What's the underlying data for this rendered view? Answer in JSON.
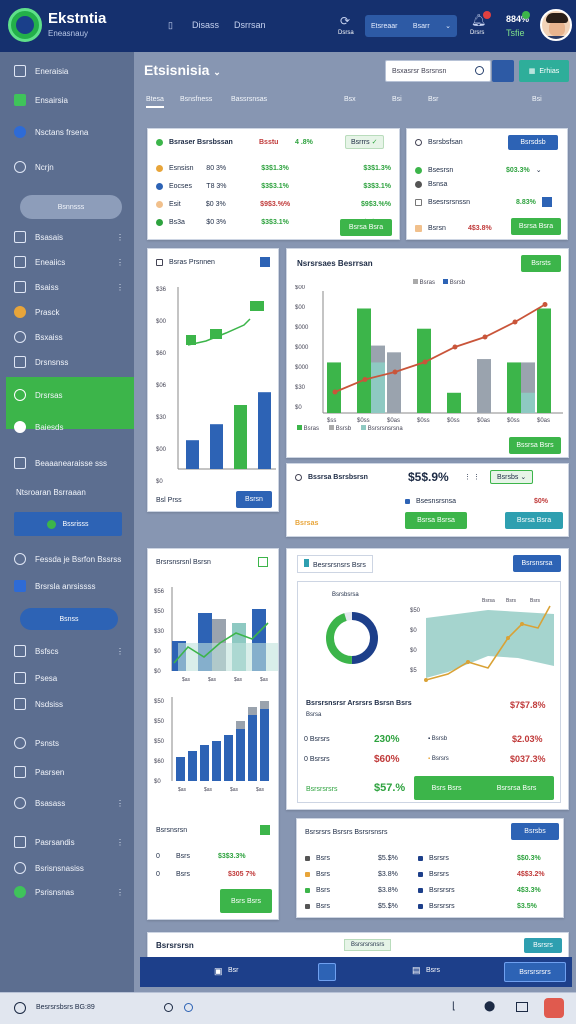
{
  "header": {
    "brand": "Ekstntia",
    "brand_sub": "Eneasnauy",
    "menu_labels": [
      "Disass",
      "Dsrrsan"
    ],
    "refresh_label": "Dsrsa",
    "dropdown_label": "Etsreaar",
    "dropdown_value": "Bsarr",
    "notif_label": "Drsrs",
    "stats_label": "884%",
    "stats_sub": "Tsfie"
  },
  "sidebar": {
    "items": [
      {
        "label": "Eneraisia"
      },
      {
        "label": "Ensairsia"
      },
      {
        "label": "Nsctans frsena"
      },
      {
        "label": "Ncrjn"
      },
      {
        "label": "Bsnnsss"
      },
      {
        "label": "Bsasais"
      },
      {
        "label": "Eneaiics"
      },
      {
        "label": "Bsaiss"
      },
      {
        "label": "Prasck"
      },
      {
        "label": "Bsxaiss"
      },
      {
        "label": "Drsnsnss"
      },
      {
        "label": "Drsrsas"
      },
      {
        "label": "Baiesds"
      },
      {
        "label": "Beaaanearaisse sss"
      },
      {
        "label": "Ntsroaran Bsrraaan"
      },
      {
        "label": "Bssrisss"
      },
      {
        "label": "Fessda je Bsrfon Bssrss"
      },
      {
        "label": "Brsrsla anrsissss"
      },
      {
        "label": "Bsnss"
      },
      {
        "label": "Bsfscs"
      },
      {
        "label": "Psesa"
      },
      {
        "label": "Nsdsiss"
      },
      {
        "label": "Psnsts"
      },
      {
        "label": "Pasrsen"
      },
      {
        "label": "Bsasass"
      },
      {
        "label": "Pasrsandis"
      },
      {
        "label": "Bsrisnsnasiss"
      },
      {
        "label": "Psrisnsnas"
      }
    ]
  },
  "main": {
    "title": "Etsisnisia",
    "search_placeholder": "Bsxasrsr Bsrsnsn",
    "action_label": "Erhias",
    "tabs": [
      "Btesa",
      "Bsnsfness",
      "Bassrsnsas",
      "Bsx",
      "Bsi",
      "Bsr",
      "Bsi"
    ]
  },
  "card_stats": {
    "title": "Bsraser Bsrsbssan",
    "header_val": "Bsstu",
    "header_pct": "4 .8%",
    "badge": "Bsrrrs",
    "rows": [
      {
        "label": "Esnsisn",
        "a": "80 3%",
        "b": "$3$1.3%",
        "color": "#e8a53a"
      },
      {
        "label": "Eocses",
        "a": "T8 3%",
        "b": "$3$3.1%",
        "color": "#2d63b5"
      },
      {
        "label": "Esit",
        "a": "$0 3%",
        "b": "$9$3.%%",
        "color": "#f1c08c"
      },
      {
        "label": "Bs3a",
        "a": "$0 3%",
        "b": "$3$3.1%",
        "color": "#2da23e"
      }
    ],
    "footer": "Bsrsa Bsra"
  },
  "card_profile": {
    "title": "Bsrsbsfsan",
    "btn": "Bsrsdsb",
    "rows": [
      {
        "label": "Bsesrsn",
        "v": "$03.3%"
      },
      {
        "label": "Bsnsa",
        "v": ""
      },
      {
        "label": "Bsesrsrsnssn",
        "v": "8.83%"
      }
    ],
    "footer_label": "Bsrsn",
    "footer_val": "4$3.8%",
    "footer_btn": "Bsrsa Bsra"
  },
  "card_bars_left": {
    "title": "Bsras Prsnnen",
    "footer_label": "Bsl Prss",
    "btn": "Bsrsn"
  },
  "card_combo": {
    "title": "Nsrsrsaes Besrrsan",
    "btn": "Bsrsts",
    "legend": [
      "Bsras",
      "Bsrsb",
      "Bsrsrsnsrsna"
    ],
    "footer_btn": "Bssrsa Bsrs"
  },
  "card_metrics": {
    "title": "Bssrsa Bsrsbsrsn",
    "value": "$5$.9%",
    "badge": "Bsrsbs",
    "row_label": "Bsesnsrsnsa",
    "row_val": "$0%",
    "foot_label": "Bsrsas",
    "btn1": "Bsrsa Bsrsa",
    "btn2": "Bsrsa Bsra"
  },
  "card_mini_charts": {
    "title": "Brsrsnsrsnl Bsrsn",
    "footer_title": "Bsrsnsrsn",
    "rows": [
      {
        "label": "Bsrs",
        "v": "$3$3.3%"
      },
      {
        "label": "Bsrs",
        "v": "$305 7%"
      }
    ],
    "btn": "Bsrs Bsrs"
  },
  "card_donut": {
    "title": "Besrsrsnsrs Bsrs",
    "btn": "Bsrsnsrsa",
    "chart_title": "Bsrsbsrsa",
    "legend": [
      "Bsrsa",
      "Bsrs",
      "Bsrs"
    ],
    "table_title": "Bsrsrsnsrsr Arsrsrs Bsrsn Bsrs",
    "table_rows": [
      {
        "label": "Bsrsa",
        "v": "$7$7.8%"
      },
      {
        "label": "Bsrsrs",
        "v": "230%",
        "m": "Bsrsb",
        "v2": "$2.03%"
      },
      {
        "label": "Bsrsrs",
        "v": "$60%",
        "m": "Bsrsrs",
        "v2": "$037.3%"
      }
    ],
    "foot_label": "Bsrsrsrsrs",
    "foot_val": "$57.%",
    "btn1": "Bsrs Bsrs",
    "btn2": "Bsrsrsa Bsrs"
  },
  "card_table": {
    "title": "Bsrsrsrs Bsrsrs Bsrsrsnsrs",
    "btn": "Bsrsbs",
    "rows": [
      {
        "a": "Bsrs",
        "b": "$5.$%",
        "c": "Bsrsrs",
        "d": "$$0.3%"
      },
      {
        "a": "Bsrs",
        "b": "$3.8%",
        "c": "Bsrsrs",
        "d": "4$$3.2%"
      },
      {
        "a": "Bsrs",
        "b": "$3.8%",
        "c": "Bsrsrsrs",
        "d": "4$3.3%"
      },
      {
        "a": "Bsrs",
        "b": "$5.$%",
        "c": "Bsrsrsrs",
        "d": "$3.5%"
      }
    ]
  },
  "card_bottom": {
    "title": "Bsrsrsrsn",
    "badge": "Bsrsrsrsnsrs",
    "btn": "Bsrsrs"
  },
  "bottombar": {
    "item1": "Bsr",
    "item2": "Bsrs",
    "btn": "Bsrsrsrsrs"
  },
  "footer": {
    "status": "Besrsrsbsrs BG:89"
  },
  "chart_data": [
    {
      "type": "bar",
      "title": "Bsras Prsnnen",
      "ylabels": [
        "$36",
        "$00",
        "$60",
        "$06",
        "$30",
        "$00",
        "$0"
      ],
      "series": [
        {
          "values": [
            1,
            2,
            3,
            4
          ],
          "color": "#2d63b5"
        },
        {
          "values": [
            4,
            6,
            9,
            12
          ],
          "color": "#3cb54a"
        }
      ],
      "top_series": [
        {
          "x": 1,
          "v": 18
        },
        {
          "x": 2,
          "v": 22
        },
        {
          "x": 3,
          "v": 26
        },
        {
          "x": 4,
          "v": 34
        }
      ],
      "bottom_series": [
        {
          "x": 1,
          "v": 18
        },
        {
          "x": 2,
          "v": 28
        },
        {
          "x": 3,
          "v": 40
        },
        {
          "x": 4,
          "v": 48
        }
      ]
    },
    {
      "type": "bar",
      "title": "Nsrsrsaes Besrrsan",
      "ylabels": [
        "$00",
        "$00",
        "$000",
        "$000",
        "$000",
        "$30",
        "$0"
      ],
      "xlabels": [
        "$ss",
        "$0ss",
        "$0as",
        "$0ss",
        "$0ss",
        "$0as",
        "$0ss",
        "$0as"
      ],
      "categories": 8,
      "green": [
        30,
        62,
        0,
        50,
        12,
        0,
        30,
        62
      ],
      "gray": [
        0,
        40,
        36,
        0,
        0,
        32,
        30,
        0
      ],
      "teal": [
        0,
        30,
        0,
        0,
        0,
        0,
        12,
        0
      ],
      "line": [
        38,
        33,
        30,
        26,
        20,
        16,
        10,
        3
      ]
    }
  ]
}
